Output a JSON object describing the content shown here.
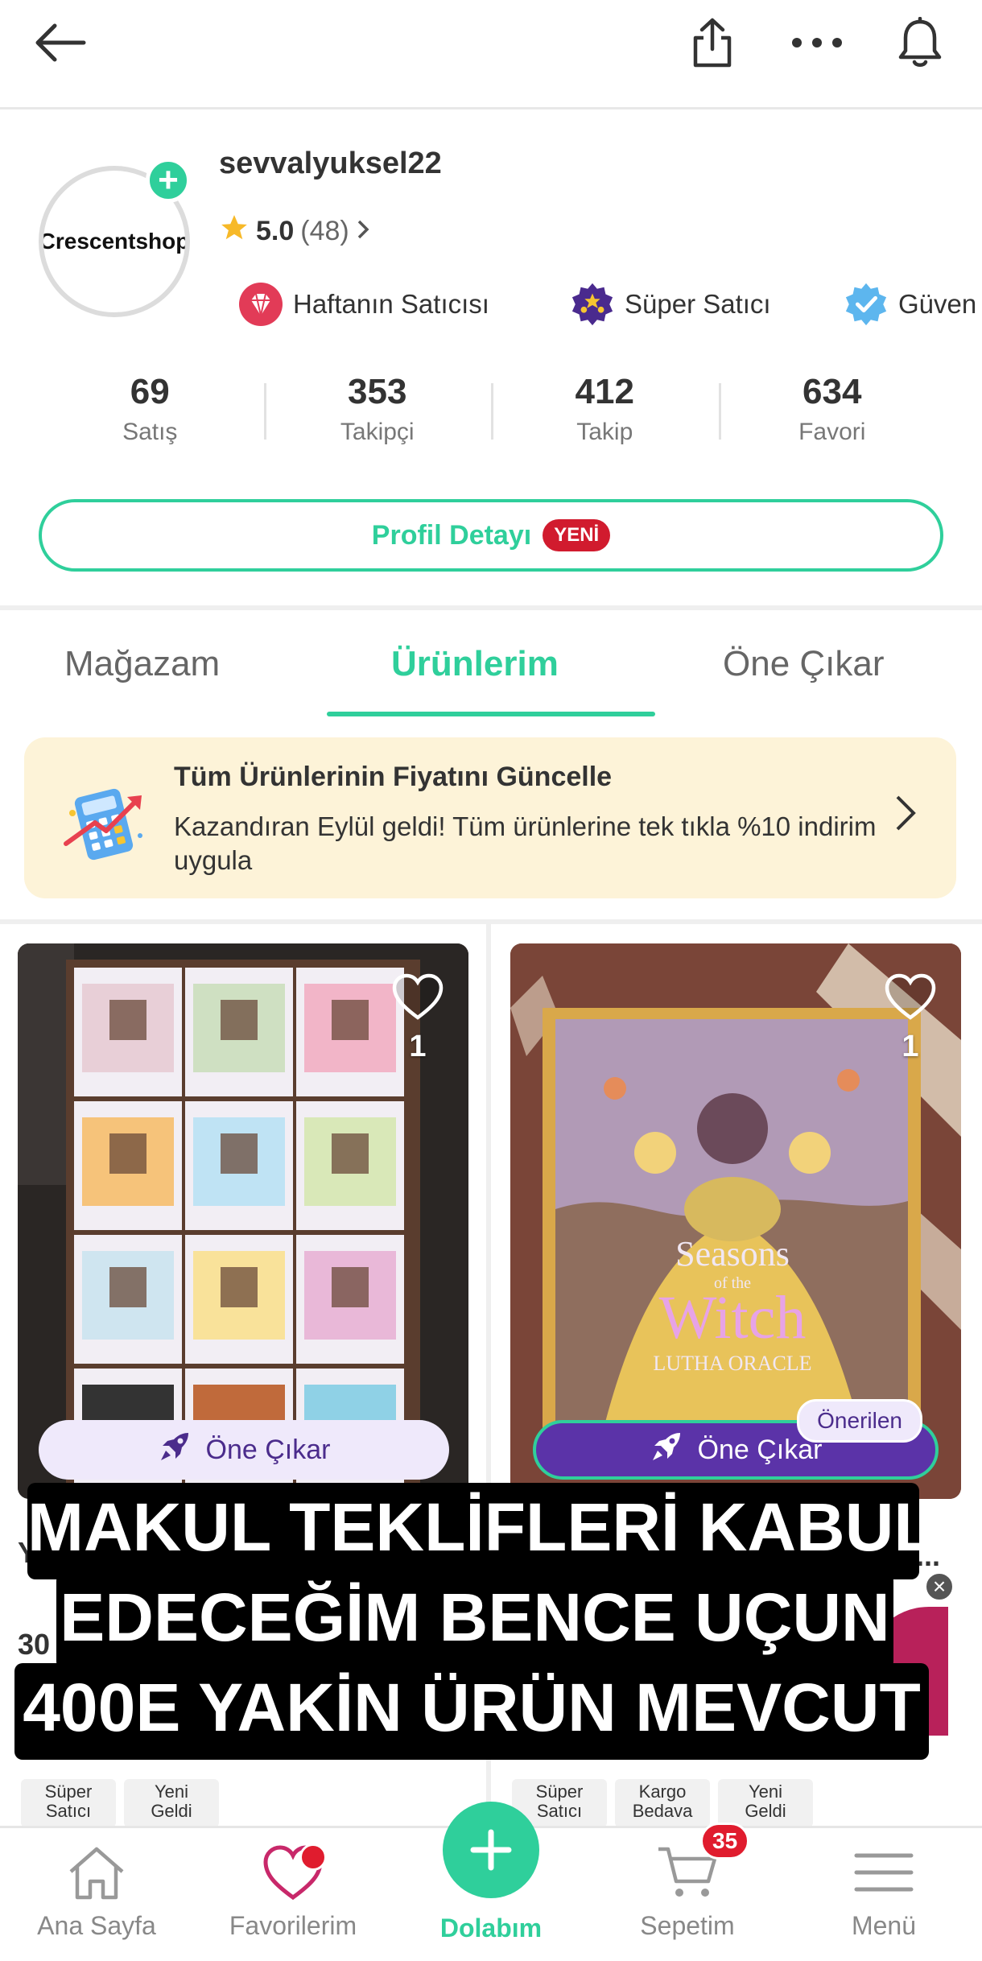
{
  "profile": {
    "avatar_text": "Crescentshop",
    "username": "sevvalyuksel22",
    "rating_score": "5.0",
    "rating_count": "(48)",
    "badges": [
      {
        "label": "Haftanın Satıcısı",
        "icon": "diamond-icon"
      },
      {
        "label": "Süper Satıcı",
        "icon": "stars-icon"
      },
      {
        "label": "Güven",
        "icon": "verified-icon"
      }
    ],
    "stats": [
      {
        "value": "69",
        "label": "Satış"
      },
      {
        "value": "353",
        "label": "Takipçi"
      },
      {
        "value": "412",
        "label": "Takip"
      },
      {
        "value": "634",
        "label": "Favori"
      }
    ],
    "detail_button": "Profil Detayı",
    "detail_new": "YENİ"
  },
  "tabs": [
    {
      "label": "Mağazam"
    },
    {
      "label": "Ürünlerim",
      "active": true
    },
    {
      "label": "Öne Çıkar"
    }
  ],
  "banner": {
    "title": "Tüm Ürünlerinin Fiyatını Güncelle",
    "text": "Kazandıran Eylül geldi! Tüm ürünlerine tek tıkla %10 indirim uygula"
  },
  "products": [
    {
      "likes": "1",
      "promote_label": "Öne Çıkar",
      "image": "lego-animal-series-boxes"
    },
    {
      "likes": "1",
      "promote_label": "Öne Çıkar",
      "recommended": "Önerilen",
      "image": "seasons-of-the-witch-oracle",
      "image_text": [
        "Seasons",
        "of the",
        "Witch",
        "LUTHA ORACLE"
      ]
    }
  ],
  "fragments": {
    "left_price": "30",
    "left_letter": "Y",
    "right_dots": "...",
    "tags_left": [
      "Süper Satıcı",
      "Yeni Geldi"
    ],
    "tags_right": [
      "Süper Satıcı",
      "Kargo Bedava",
      "Yeni Geldi"
    ]
  },
  "caption": [
    "MAKUL TEKLİFLERİ KABUL",
    "EDECEĞİM BENCE UÇUN",
    "400E YAKİN ÜRÜN MEVCUT"
  ],
  "bottom_nav": [
    {
      "label": "Ana Sayfa",
      "icon": "home-icon"
    },
    {
      "label": "Favorilerim",
      "icon": "heart-icon"
    },
    {
      "label": "Dolabım",
      "icon": "plus-icon"
    },
    {
      "label": "Sepetim",
      "icon": "cart-icon",
      "badge": "35"
    },
    {
      "label": "Menü",
      "icon": "menu-icon"
    }
  ],
  "colors": {
    "accent": "#2fcf9b",
    "badge_red": "#d11b2e",
    "promote_purple": "#5b33a8",
    "banner_bg": "#fdf3d8"
  }
}
